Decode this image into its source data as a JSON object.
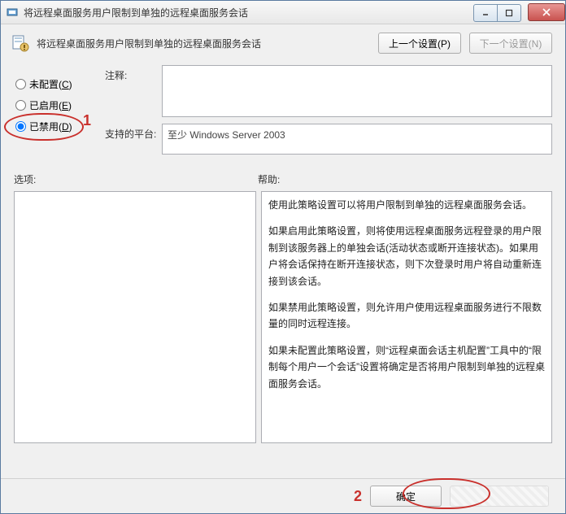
{
  "window": {
    "title": "将远程桌面服务用户限制到单独的远程桌面服务会话"
  },
  "header": {
    "title": "将远程桌面服务用户限制到单独的远程桌面服务会话",
    "prev_button": "上一个设置(P)",
    "next_button": "下一个设置(N)"
  },
  "config": {
    "radios": {
      "not_configured": "未配置(C)",
      "enabled": "已启用(E)",
      "disabled": "已禁用(D)",
      "selected": "disabled"
    },
    "comment_label": "注释:",
    "comment_value": "",
    "platform_label": "支持的平台:",
    "platform_value": "至少 Windows Server 2003"
  },
  "sections": {
    "options_label": "选项:",
    "help_label": "帮助:"
  },
  "help_text": {
    "p1": "使用此策略设置可以将用户限制到单独的远程桌面服务会话。",
    "p2": "如果启用此策略设置，则将使用远程桌面服务远程登录的用户限制到该服务器上的单独会话(活动状态或断开连接状态)。如果用户将会话保持在断开连接状态，则下次登录时用户将自动重新连接到该会话。",
    "p3": "如果禁用此策略设置，则允许用户使用远程桌面服务进行不限数量的同时远程连接。",
    "p4": "如果未配置此策略设置，则“远程桌面会话主机配置”工具中的“限制每个用户一个会话”设置将确定是否将用户限制到单独的远程桌面服务会话。"
  },
  "footer": {
    "ok": "确定"
  },
  "annotations": {
    "mark1": "1",
    "mark2": "2"
  }
}
